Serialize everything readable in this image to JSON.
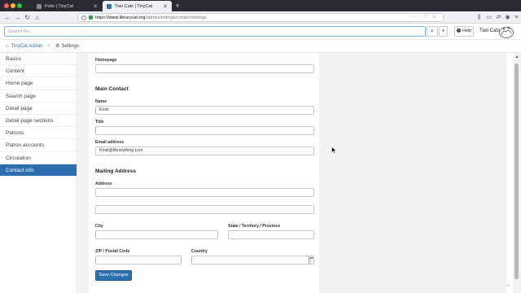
{
  "browser": {
    "tabs": [
      {
        "title": "Folio | TinyCat",
        "close": "✕"
      },
      {
        "title": "Two Cats | TinyCat",
        "close": "✕"
      }
    ],
    "new_tab": "+",
    "url_host": "https://www.librarycat.org",
    "url_path": "/admin/settings/contactsettings",
    "url_actions": "··· ♡ ☆",
    "nav": {
      "back": "←",
      "forward": "→",
      "reload": "↻",
      "home": "⌂"
    },
    "toolbar_icons": {
      "library": "⫼",
      "reader": "▭",
      "sync": "⇄",
      "profile": "◉",
      "menu": "≡"
    }
  },
  "header": {
    "search_placeholder": "Search for...",
    "search_glyph": "⌕",
    "dropdown_glyph": "▾",
    "help_glyph": "?",
    "help_label": "Help",
    "library_name": "Two Cats"
  },
  "breadcrumb": {
    "home_glyph": "⌂",
    "home_label": "TinyCat Admin",
    "separator": ">",
    "gear_glyph": "⚙",
    "current_label": "Settings"
  },
  "sidebar": {
    "items": [
      {
        "label": "Basics"
      },
      {
        "label": "Content"
      },
      {
        "label": "Home page"
      },
      {
        "label": "Search page"
      },
      {
        "label": "Detail page"
      },
      {
        "label": "Detail page sections"
      },
      {
        "label": "Patrons"
      },
      {
        "label": "Patron accounts"
      },
      {
        "label": "Circulation"
      },
      {
        "label": "Contact info",
        "active": true
      }
    ]
  },
  "form": {
    "homepage_label": "Homepage",
    "homepage_value": "",
    "main_contact_heading": "Main Contact",
    "name_label": "Name",
    "name_value": "Kristi",
    "title_label": "Title",
    "title_value": "",
    "email_label": "Email address",
    "email_value": "Kristi@librarything.com",
    "mailing_heading": "Mailing Address",
    "address_label": "Address",
    "address_line1": "",
    "address_line2": "",
    "city_label": "City",
    "city_value": "",
    "state_label": "State / Territory / Province",
    "state_value": "",
    "zip_label": "ZIP / Postal Code",
    "zip_value": "",
    "country_label": "Country",
    "country_value": "",
    "country_caret": "▴▾",
    "save_label": "Save Changes"
  },
  "page": {
    "scroll_up_glyph": "▲",
    "back_to_top_glyph": "⌂"
  },
  "colors": {
    "accent": "#2c6eaf",
    "sidebar_active_bg": "#2c6eaf",
    "main_bg": "#f2f2f2",
    "browser_dark": "#2b2a33"
  }
}
